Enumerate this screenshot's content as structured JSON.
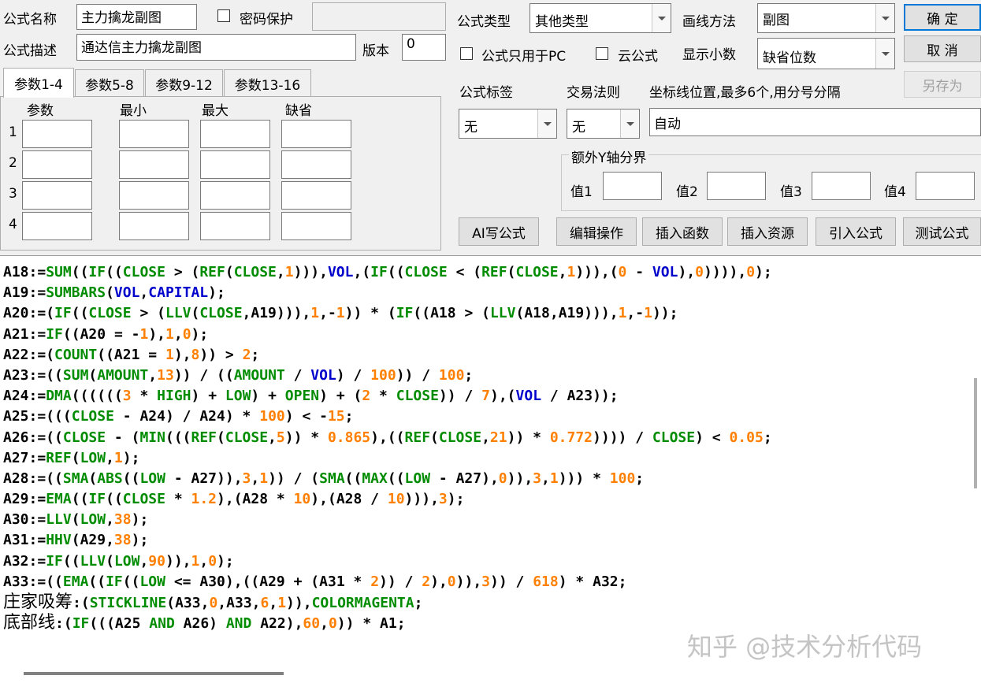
{
  "top": {
    "name_label": "公式名称",
    "name_value": "主力擒龙副图",
    "password_label": "密码保护",
    "password_value": "",
    "desc_label": "公式描述",
    "desc_value": "通达信主力擒龙副图",
    "version_label": "版本",
    "version_value": "0",
    "type_label": "公式类型",
    "type_value": "其他类型",
    "draw_label": "画线方法",
    "draw_value": "副图",
    "pc_only_label": "公式只用于PC",
    "cloud_label": "云公式",
    "decimals_label": "显示小数",
    "decimals_value": "缺省位数",
    "tag_label": "公式标签",
    "tag_value": "无",
    "rule_label": "交易法则",
    "rule_value": "无",
    "coord_label": "坐标线位置,最多6个,用分号分隔",
    "coord_value": "自动",
    "yaxis_group": "额外Y轴分界",
    "y_labels": [
      "值1",
      "值2",
      "值3",
      "值4"
    ]
  },
  "buttons": {
    "ok": "确  定",
    "cancel": "取  消",
    "save_as": "另存为",
    "ai": "AI写公式",
    "edit": "编辑操作",
    "insert_fn": "插入函数",
    "insert_res": "插入资源",
    "import": "引入公式",
    "test": "测试公式"
  },
  "tabs": [
    "参数1-4",
    "参数5-8",
    "参数9-12",
    "参数13-16"
  ],
  "params": {
    "headers": [
      "参数",
      "最小",
      "最大",
      "缺省"
    ],
    "rows": [
      "1",
      "2",
      "3",
      "4"
    ]
  },
  "code_lines": [
    "A18:=SUM((IF((CLOSE > (REF(CLOSE,1))),VOL,(IF((CLOSE < (REF(CLOSE,1))),(0 - VOL),0)))),0);",
    "A19:=SUMBARS(VOL,CAPITAL);",
    "A20:=(IF((CLOSE > (LLV(CLOSE,A19))),1,-1)) * (IF((A18 > (LLV(A18,A19))),1,-1));",
    "A21:=IF((A20 = -1),1,0);",
    "A22:=(COUNT((A21 = 1),8)) > 2;",
    "A23:=((SUM(AMOUNT,13)) / ((AMOUNT / VOL) / 100)) / 100;",
    "A24:=DMA((((((3 * HIGH) + LOW) + OPEN) + (2 * CLOSE)) / 7),(VOL / A23));",
    "A25:=(((CLOSE - A24) / A24) * 100) < -15;",
    "A26:=((CLOSE - (MIN(((REF(CLOSE,5)) * 0.865),((REF(CLOSE,21)) * 0.772)))) / CLOSE) < 0.05;",
    "A27:=REF(LOW,1);",
    "A28:=((SMA(ABS((LOW - A27)),3,1)) / (SMA((MAX((LOW - A27),0)),3,1))) * 100;",
    "A29:=EMA((IF((CLOSE * 1.2),(A28 * 10),(A28 / 10))),3);",
    "A30:=LLV(LOW,38);",
    "A31:=HHV(A29,38);",
    "A32:=IF((LLV(LOW,90)),1,0);",
    "A33:=((EMA((IF((LOW <= A30),((A29 + (A31 * 2)) / 2),0)),3)) / 618) * A32;",
    "庄家吸筹:(STICKLINE(A33,0,A33,6,1)),COLORMAGENTA;",
    "底部线:(IF(((A25 AND A26) AND A22),60,0)) * A1;"
  ],
  "watermark": "知乎 @技术分析代码"
}
